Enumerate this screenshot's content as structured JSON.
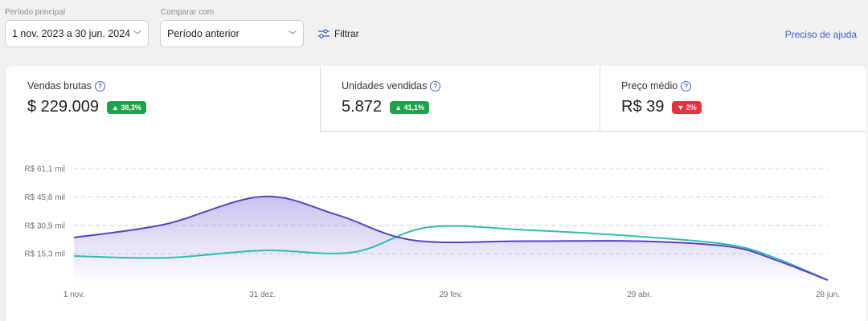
{
  "filters": {
    "period_label": "Período principal",
    "period_value": "1 nov. 2023 a 30 jun. 2024",
    "compare_label": "Comparar com",
    "compare_value": "Período anterior",
    "filter_label": "Filtrar",
    "help_label": "Preciso de ajuda"
  },
  "kpis": [
    {
      "label": "Vendas brutas",
      "value": "$ 229.009",
      "change": "▲ 38,3%",
      "trend": "up"
    },
    {
      "label": "Unidades vendidas",
      "value": "5.872",
      "change": "▲ 41,1%",
      "trend": "up"
    },
    {
      "label": "Preço médio",
      "value": "R$ 39",
      "change": "▼ 2%",
      "trend": "down"
    }
  ],
  "colors": {
    "primary_series": "#5b3fc4",
    "compare_series": "#2ebcb4",
    "up": "#1fa24a",
    "down": "#e0343e",
    "link": "#3a61c7"
  },
  "chart_data": {
    "type": "area",
    "y_tick_labels": [
      "R$ 61,1 mil",
      "R$ 45,8 mil",
      "R$ 30,5 mil",
      "R$ 15,3 mil"
    ],
    "y_ticks": [
      61.1,
      45.8,
      30.5,
      15.3
    ],
    "x_tick_labels": [
      "1 nov.",
      "31 dez.",
      "29 fev.",
      "29 abr.",
      "28 jun."
    ],
    "ylim": [
      0,
      66
    ],
    "grid": true,
    "series": [
      {
        "values": [
          [
            0,
            24
          ],
          [
            0.12,
            31
          ],
          [
            0.25,
            46
          ],
          [
            0.35,
            36
          ],
          [
            0.45,
            22.5
          ],
          [
            0.6,
            22
          ],
          [
            0.75,
            22
          ],
          [
            0.87,
            19
          ],
          [
            0.93,
            12
          ],
          [
            1,
            1
          ]
        ]
      },
      {
        "values": [
          [
            0,
            14
          ],
          [
            0.12,
            13
          ],
          [
            0.25,
            17
          ],
          [
            0.37,
            16
          ],
          [
            0.47,
            29.5
          ],
          [
            0.6,
            28
          ],
          [
            0.75,
            24.5
          ],
          [
            0.87,
            20
          ],
          [
            0.93,
            13
          ],
          [
            1,
            1
          ]
        ]
      }
    ]
  }
}
